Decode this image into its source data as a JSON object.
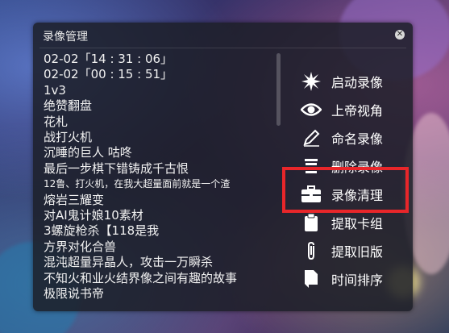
{
  "panel": {
    "title": "录像管理",
    "close_icon": "close-icon"
  },
  "recordings": [
    "02-02「14 : 31 : 06」",
    "02-02「00 : 15 : 51」",
    "1v3",
    "绝赞翻盘",
    "花札",
    "战打火机",
    "沉睡的巨人 咕咚",
    "最后一步棋下错铸成千古恨",
    "12鲁、打火机，在我大超量面前就是一个渣",
    "熔岩三耀变",
    "对AI鬼计娘10素材",
    "3螺旋枪杀【118是我",
    "方界对化合兽",
    "混沌超量异晶人，攻击一万瞬杀",
    "不知火和业火结界像之间有趣的故事",
    "极限说书帝"
  ],
  "menu": [
    {
      "label": "启动录像",
      "icon": "starburst-icon"
    },
    {
      "label": "上帝视角",
      "icon": "eye-icon"
    },
    {
      "label": "命名录像",
      "icon": "pencil-icon"
    },
    {
      "label": "删除录像",
      "icon": "trash-icon"
    },
    {
      "label": "录像清理",
      "icon": "toolbox-icon"
    },
    {
      "label": "提取卡组",
      "icon": "clipboard-icon"
    },
    {
      "label": "提取旧版",
      "icon": "paperclip-icon"
    },
    {
      "label": "时间排序",
      "icon": "document-icon"
    }
  ],
  "colors": {
    "highlight": "#e8262a",
    "panel_bg": "#1c1e28"
  }
}
